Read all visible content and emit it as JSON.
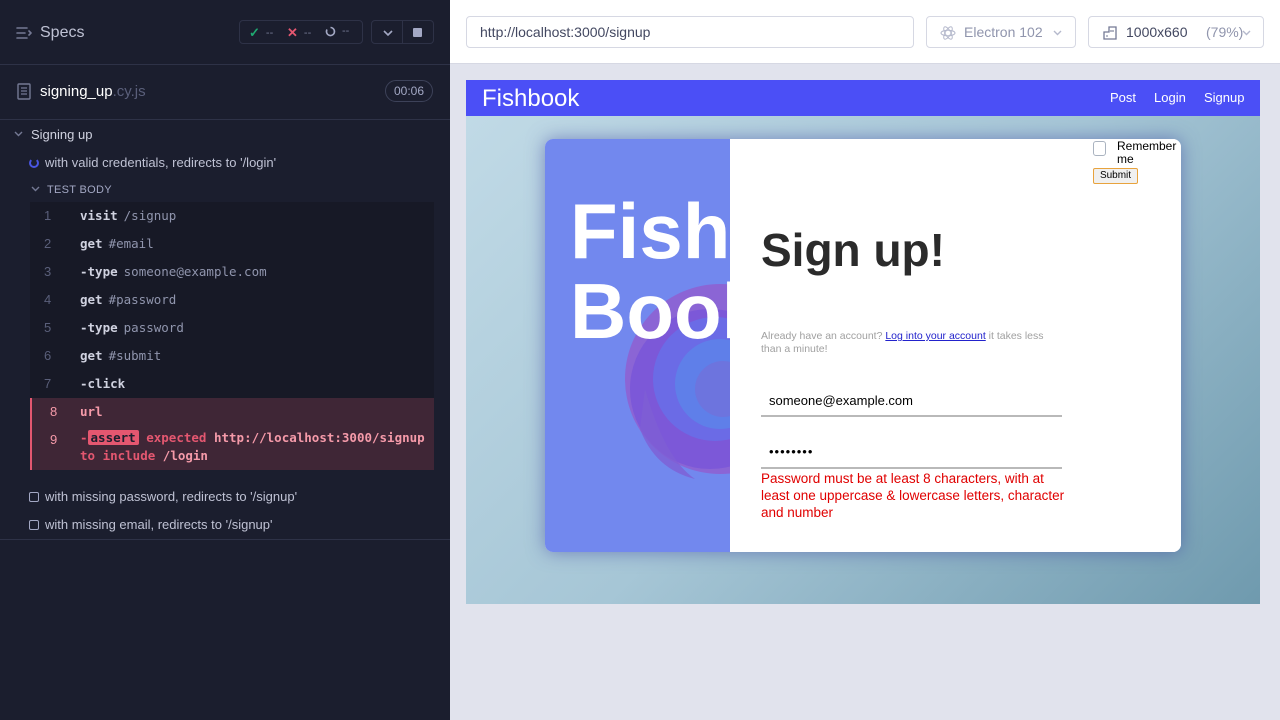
{
  "reporter": {
    "specs_label": "Specs",
    "stats": {
      "passed": "--",
      "failed": "--",
      "pending": "--"
    },
    "spec_file": {
      "name": "signing_up",
      "ext": ".cy.js",
      "duration": "00:06"
    },
    "suite": {
      "title": "Signing up",
      "tests": [
        {
          "title": "with valid credentials, redirects to '/login'",
          "state": "running"
        },
        {
          "title": "with missing password, redirects to '/signup'",
          "state": "pending"
        },
        {
          "title": "with missing email, redirects to '/signup'",
          "state": "pending"
        }
      ]
    },
    "test_body_label": "TEST BODY",
    "commands": [
      {
        "num": "1",
        "name": "visit",
        "message": "/signup"
      },
      {
        "num": "2",
        "name": "get",
        "message": "#email"
      },
      {
        "num": "3",
        "name": "-type",
        "message": "someone@example.com"
      },
      {
        "num": "4",
        "name": "get",
        "message": "#password"
      },
      {
        "num": "5",
        "name": "-type",
        "message": "password"
      },
      {
        "num": "6",
        "name": "get",
        "message": "#submit"
      },
      {
        "num": "7",
        "name": "-click",
        "message": ""
      },
      {
        "num": "8",
        "name": "url",
        "message": ""
      },
      {
        "num": "9",
        "name": "-",
        "badge": "assert",
        "expected": "expected",
        "url": "http://localhost:3000/signup",
        "to_include": "to include",
        "value": "/login"
      }
    ]
  },
  "topbar": {
    "url": "http://localhost:3000/signup",
    "browser": "Electron 102",
    "viewport_size": "1000x660",
    "viewport_scale": "(79%)"
  },
  "app": {
    "brand": "Fishbook",
    "nav": {
      "post": "Post",
      "login": "Login",
      "signup": "Signup"
    },
    "hero_line1": "Fish",
    "hero_line2": "Book",
    "remember_label": "Remember me",
    "submit_label": "Submit",
    "title": "Sign up!",
    "already_text": "Already have an account?",
    "login_link": "Log into your account",
    "already_suffix": "it takes less than a minute!",
    "email_value": "someone@example.com",
    "password_value": "••••••••",
    "password_error": "Password must be at least 8 characters, with at least one uppercase & lowercase letters, character and number"
  },
  "colors": {
    "reporter_bg": "#1b1e2e",
    "failed": "#e45770",
    "passed": "#1fa971",
    "running": "#4956e3",
    "app_nav": "#4b4ff6",
    "error": "#e00000"
  }
}
